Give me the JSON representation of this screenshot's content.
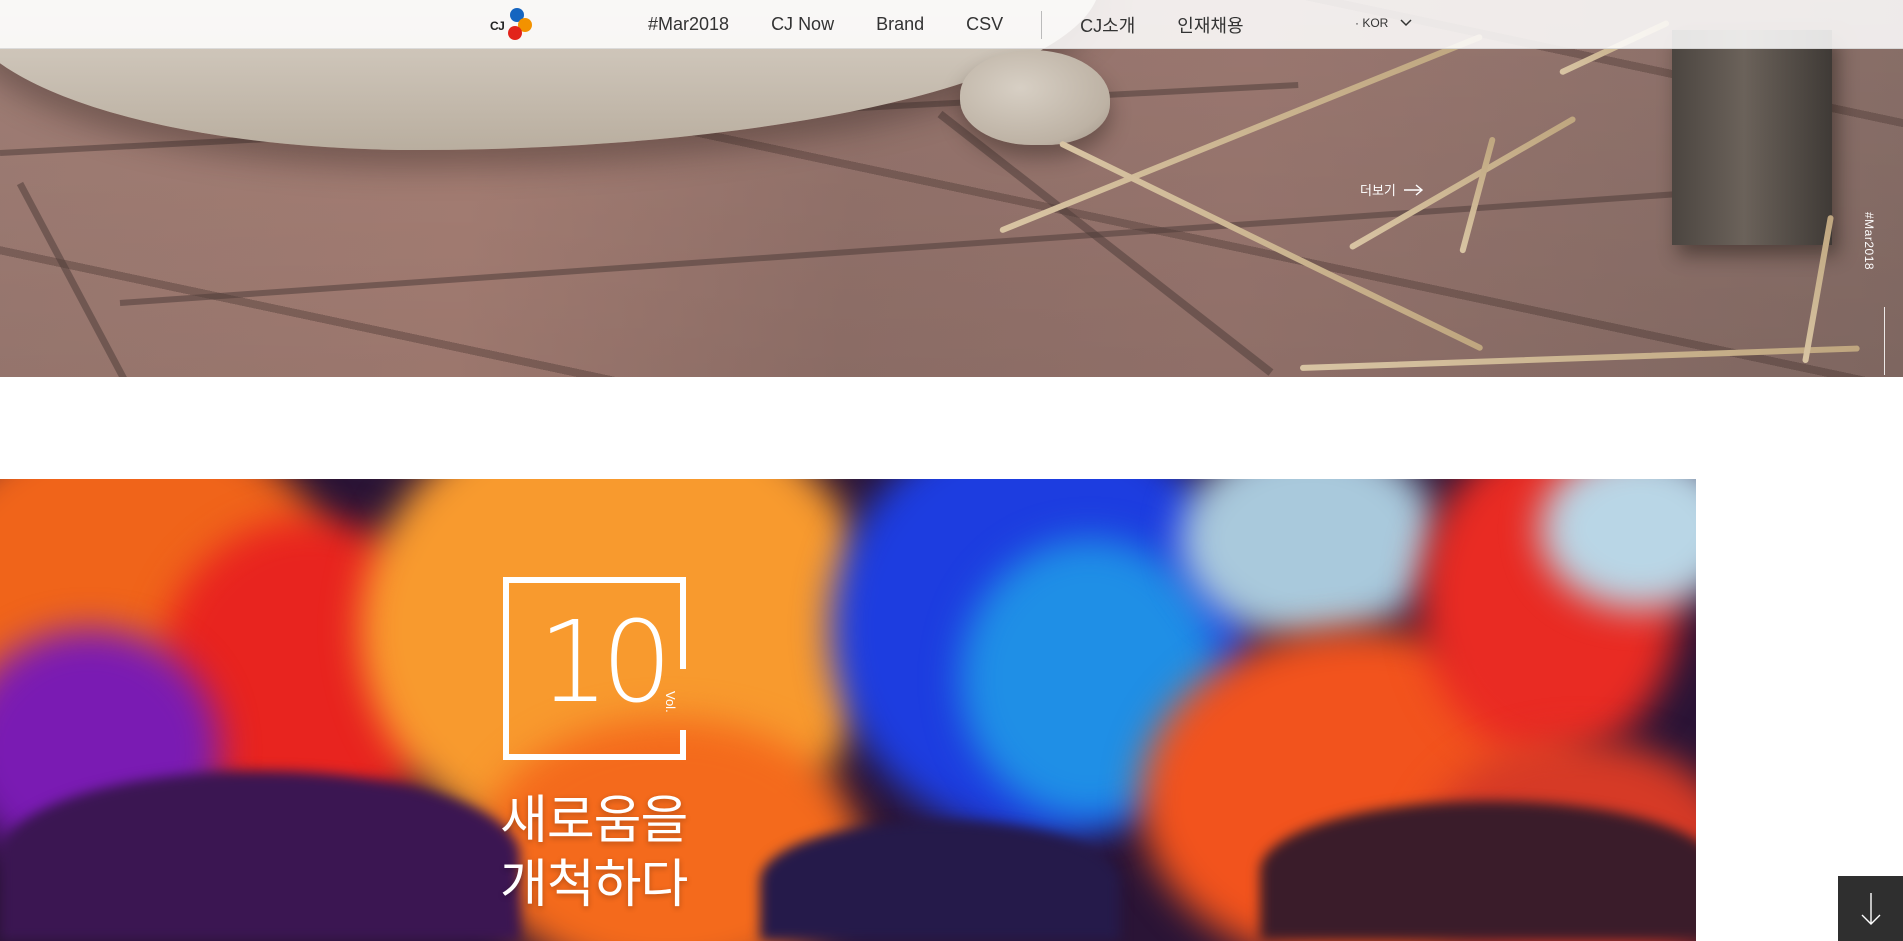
{
  "header": {
    "logo_text": "CJ",
    "nav": [
      {
        "label": "#Mar2018"
      },
      {
        "label": "CJ Now"
      },
      {
        "label": "Brand"
      },
      {
        "label": "CSV"
      },
      {
        "label": "CJ소개"
      },
      {
        "label": "인재채용"
      }
    ],
    "language": {
      "label": "· KOR",
      "icon": "chevron-down-icon"
    }
  },
  "hero_top": {
    "more_label": "더보기",
    "more_icon": "arrow-right-icon",
    "side_label": "#Mar2018"
  },
  "hero_bottom": {
    "volume_number": "10",
    "volume_label": "Vol.",
    "headline_line1": "새로움을",
    "headline_line2": "개척하다"
  },
  "scroll_button": {
    "icon": "arrow-down-icon"
  },
  "colors": {
    "logo_blue": "#1565c0",
    "logo_orange": "#f39200",
    "logo_red": "#e2231a",
    "scroll_button_bg": "#2f2f2f"
  }
}
